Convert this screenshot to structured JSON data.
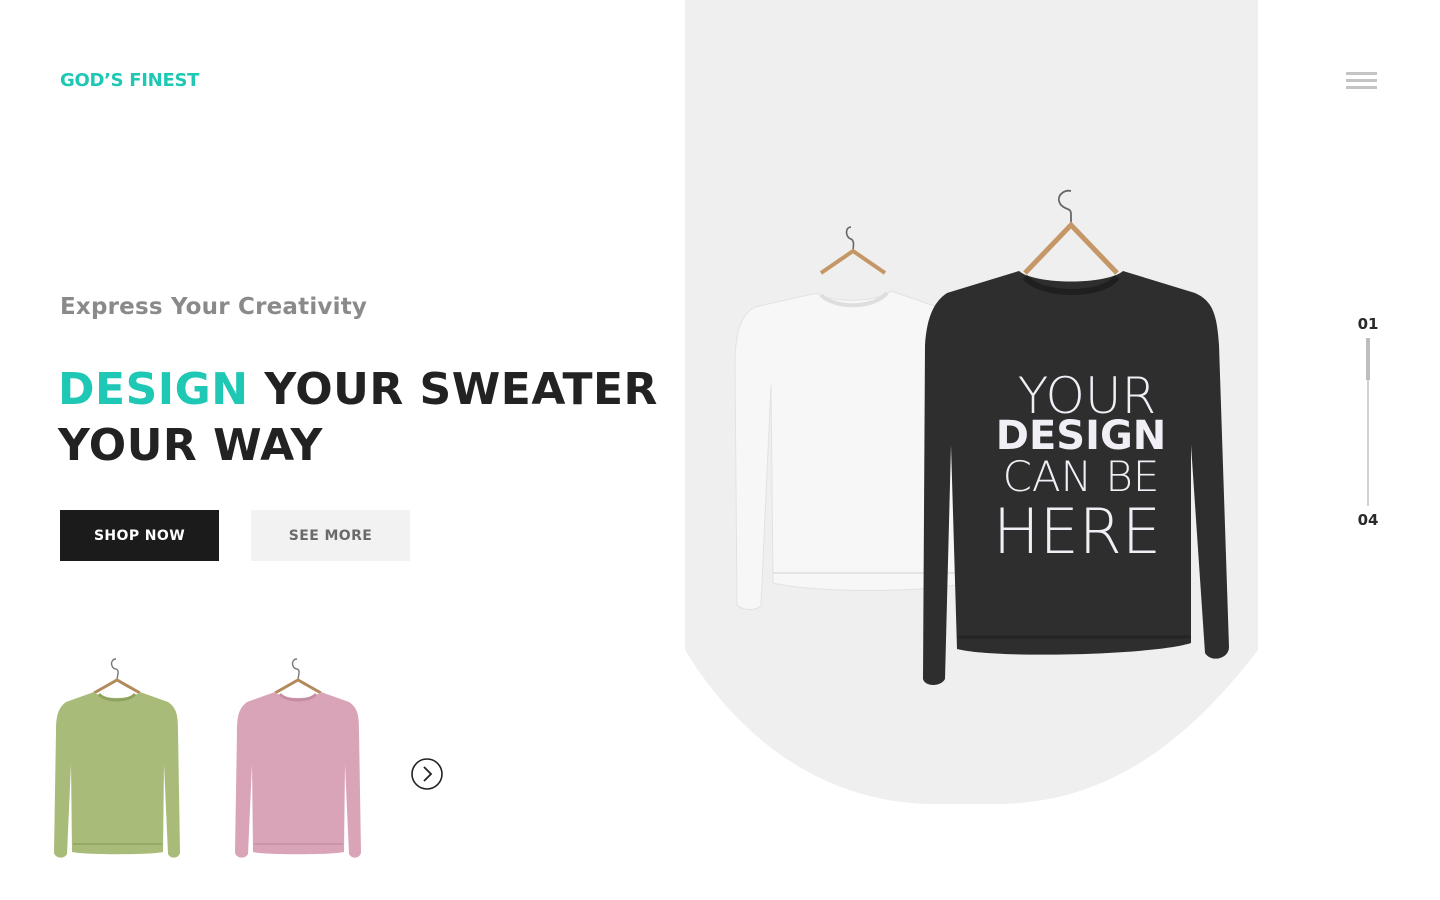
{
  "brand": {
    "logo_text": "GOD’S FINEST",
    "accent_color": "#1ec8b4"
  },
  "header": {
    "menu_icon": "hamburger-icon"
  },
  "hero": {
    "tagline": "Express Your Creativity",
    "headline_accent": "DESIGN",
    "headline_rest": " YOUR SWEATER YOUR WAY",
    "primary_button": "SHOP NOW",
    "secondary_button": "SEE MORE"
  },
  "featured_product": {
    "print_lines": [
      "YOUR",
      "DESIGN",
      "CAN BE",
      "HERE"
    ],
    "colors": [
      "white",
      "black"
    ]
  },
  "thumbnails": [
    {
      "name": "green-sweater",
      "color": "#a9bb79"
    },
    {
      "name": "pink-sweater",
      "color": "#d9a4b7"
    }
  ],
  "carousel": {
    "next_icon": "chevron-right-circle-icon"
  },
  "slides": {
    "current": "01",
    "total": "04",
    "progress": 0.25
  },
  "colors": {
    "text_dark": "#222222",
    "muted": "#8a8a8a",
    "panel_bg": "#efefef"
  }
}
